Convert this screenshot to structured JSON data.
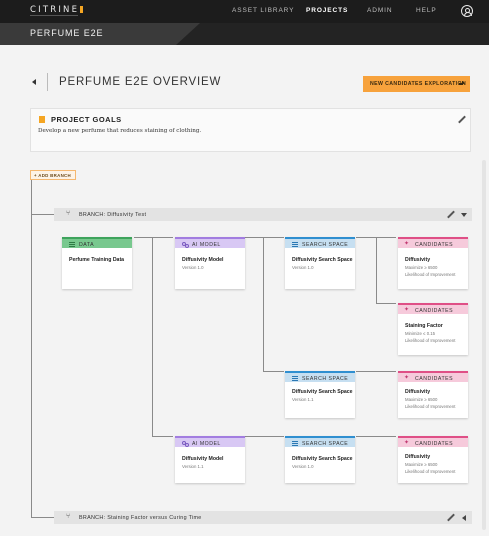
{
  "nav": {
    "logo": "CITRINE",
    "items": [
      "ASSET LIBRARY",
      "PROJECTS",
      "ADMIN",
      "HELP"
    ],
    "active": "PROJECTS"
  },
  "project": {
    "name": "PERFUME E2E"
  },
  "header": {
    "title": "PERFUME E2E OVERVIEW",
    "new_candidates_label": "NEW CANDIDATES EXPLORATION"
  },
  "goals": {
    "title": "PROJECT GOALS",
    "text": "Develop a new perfume that reduces staining of clothing."
  },
  "add_branch_label": "+ ADD BRANCH",
  "branches": [
    {
      "prefix": "BRANCH:",
      "name": "Diffusivity Test"
    },
    {
      "prefix": "BRANCH:",
      "name": "Staining Factor versus Curing Time"
    }
  ],
  "cards": {
    "data": {
      "type": "DATA",
      "title": "Perfume Training Data"
    },
    "model_1": {
      "type": "AI MODEL",
      "title": "Diffusivity Model",
      "sub": "Version 1.0"
    },
    "model_2": {
      "type": "AI MODEL",
      "title": "Diffusivity Model",
      "sub": "Version 1.1"
    },
    "space_1": {
      "type": "SEARCH SPACE",
      "title": "Diffusivity Search Space",
      "sub": "Version 1.0"
    },
    "space_2": {
      "type": "SEARCH SPACE",
      "title": "Diffusivity Search Space",
      "sub": "Version 1.1"
    },
    "space_3": {
      "type": "SEARCH SPACE",
      "title": "Diffusivity Search Space",
      "sub": "Version 1.0"
    },
    "cand_1": {
      "type": "CANDIDATES",
      "title": "Diffusivity",
      "sub1": "Maximize ≥ 6500",
      "sub2": "Likelihood of Improvement"
    },
    "cand_2": {
      "type": "CANDIDATES",
      "title": "Staining Factor",
      "sub1": "Minimize ≤ 0.15",
      "sub2": "Likelihood of Improvement"
    },
    "cand_3": {
      "type": "CANDIDATES",
      "title": "Diffusivity",
      "sub1": "Maximize ≥ 6500",
      "sub2": "Likelihood of Improvement"
    },
    "cand_4": {
      "type": "CANDIDATES",
      "title": "Diffusivity",
      "sub1": "Maximize ≥ 6500",
      "sub2": "Likelihood of Improvement"
    }
  },
  "colors": {
    "accent": "#f7a23c",
    "data": "#78c88e",
    "ai_model": "#d8c8f4",
    "search_space": "#c6dff1",
    "candidates": "#f6cadb"
  }
}
